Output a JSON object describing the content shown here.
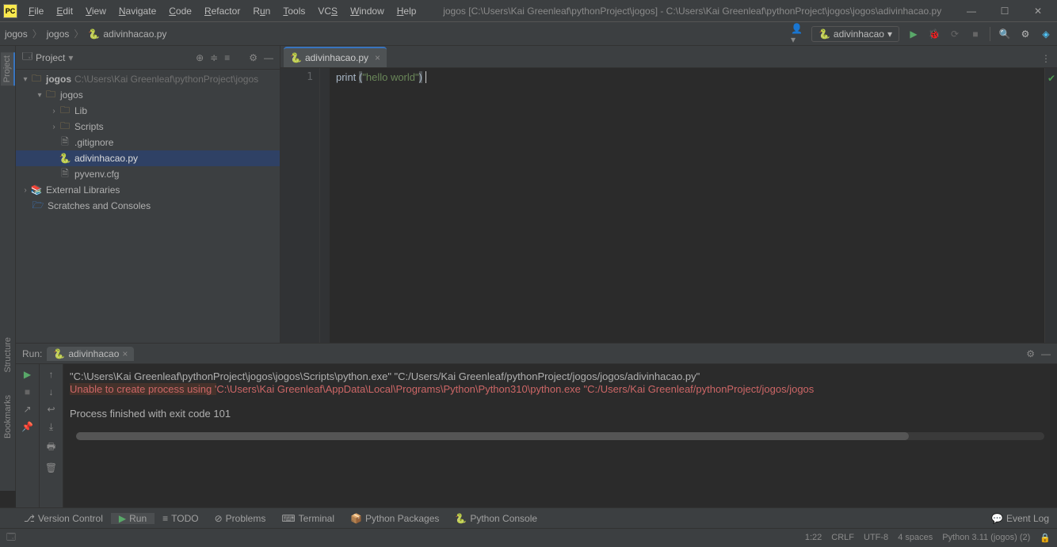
{
  "titlebar": {
    "logo": "PC",
    "title": "jogos [C:\\Users\\Kai Greenleaf\\pythonProject\\jogos] - C:\\Users\\Kai Greenleaf\\pythonProject\\jogos\\jogos\\adivinhacao.py"
  },
  "menu": {
    "file": "File",
    "edit": "Edit",
    "view": "View",
    "navigate": "Navigate",
    "code": "Code",
    "refactor": "Refactor",
    "run": "Run",
    "tools": "Tools",
    "vcs": "VCS",
    "window": "Window",
    "help": "Help"
  },
  "breadcrumb": {
    "a": "jogos",
    "b": "jogos",
    "c": "adivinhacao.py"
  },
  "run_cfg": "adivinhacao",
  "panel": {
    "title": "Project"
  },
  "tree": {
    "root": "jogos",
    "root_path": "C:\\Users\\Kai Greenleaf\\pythonProject\\jogos",
    "sub": "jogos",
    "lib": "Lib",
    "scripts": "Scripts",
    "gitignore": ".gitignore",
    "main": "adivinhacao.py",
    "cfg": "pyvenv.cfg",
    "ext": "External Libraries",
    "scratch": "Scratches and Consoles"
  },
  "tab": "adivinhacao.py",
  "gutter": "1",
  "code": {
    "fn": "print ",
    "p1": "(",
    "str": "\"hello world\"",
    "p2": ")"
  },
  "run_panel": {
    "label": "Run:",
    "tab": "adivinhacao",
    "line1": "\"C:\\Users\\Kai Greenleaf\\pythonProject\\jogos\\jogos\\Scripts\\python.exe\" \"C:/Users/Kai Greenleaf/pythonProject/jogos/jogos/adivinhacao.py\"",
    "line2a": "Unable to create process using '",
    "line2b": "C:\\Users\\Kai Greenleaf\\AppData\\Local\\Programs\\Python\\Python310\\python.exe \"C:/Users/Kai Greenleaf/pythonProject/jogos/jogos",
    "line3": "Process finished with exit code 101"
  },
  "tools": {
    "vc": "Version Control",
    "run": "Run",
    "todo": "TODO",
    "problems": "Problems",
    "terminal": "Terminal",
    "pkg": "Python Packages",
    "console": "Python Console",
    "event": "Event Log"
  },
  "status": {
    "pos": "1:22",
    "eol": "CRLF",
    "enc": "UTF-8",
    "indent": "4 spaces",
    "sdk": "Python 3.11 (jogos) (2)"
  },
  "side": {
    "project": "Project",
    "structure": "Structure",
    "bookmarks": "Bookmarks"
  }
}
